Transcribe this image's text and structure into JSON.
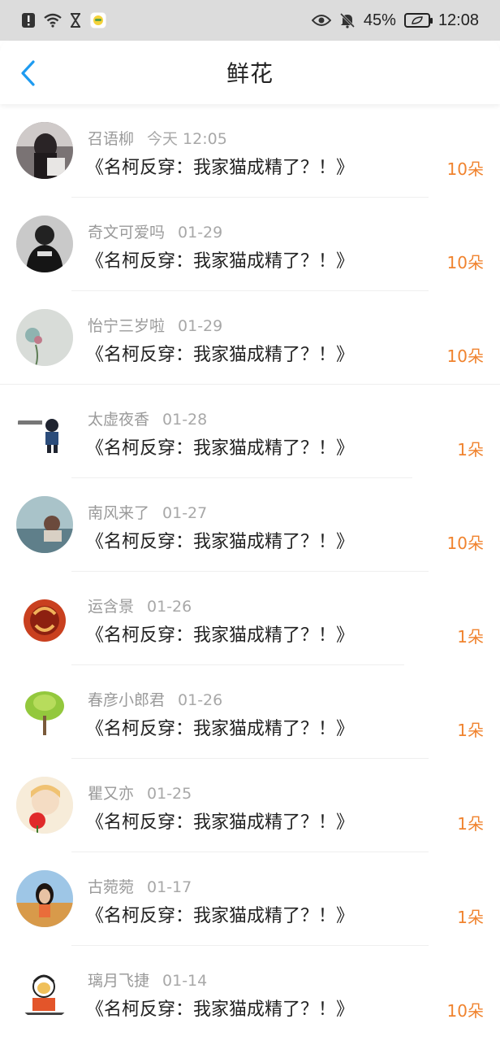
{
  "status_bar": {
    "battery_percent": "45%",
    "time": "12:08",
    "icons": [
      "alert-icon",
      "wifi-icon",
      "hourglass-icon",
      "app-notification-icon",
      "eye-icon",
      "bell-muted-icon",
      "battery-icon"
    ]
  },
  "header": {
    "title": "鲜花",
    "back_icon": "chevron-left-icon"
  },
  "colors": {
    "accent_blue": "#1e9bf0",
    "count_orange": "#f0832e",
    "meta_gray": "#9a9a9a"
  },
  "items": [
    {
      "name": "召语柳",
      "date": "今天 12:05",
      "book": "《名柯反穿：我家猫成精了？！》",
      "count": "10朵"
    },
    {
      "name": "奇文可爱吗",
      "date": "01-29",
      "book": "《名柯反穿：我家猫成精了？！》",
      "count": "10朵"
    },
    {
      "name": "怡宁三岁啦",
      "date": "01-29",
      "book": "《名柯反穿：我家猫成精了？！》",
      "count": "10朵"
    },
    {
      "name": "太虚夜香",
      "date": "01-28",
      "book": "《名柯反穿：我家猫成精了？！》",
      "count": "1朵"
    },
    {
      "name": "南风来了",
      "date": "01-27",
      "book": "《名柯反穿：我家猫成精了？！》",
      "count": "10朵"
    },
    {
      "name": "运含景",
      "date": "01-26",
      "book": "《名柯反穿：我家猫成精了？！》",
      "count": "1朵"
    },
    {
      "name": "春彦小郎君",
      "date": "01-26",
      "book": "《名柯反穿：我家猫成精了？！》",
      "count": "1朵"
    },
    {
      "name": "瞿又亦",
      "date": "01-25",
      "book": "《名柯反穿：我家猫成精了？！》",
      "count": "1朵"
    },
    {
      "name": "古菀菀",
      "date": "01-17",
      "book": "《名柯反穿：我家猫成精了？！》",
      "count": "1朵"
    },
    {
      "name": "璃月飞捷",
      "date": "01-14",
      "book": "《名柯反穿：我家猫成精了？！》",
      "count": "10朵"
    }
  ]
}
